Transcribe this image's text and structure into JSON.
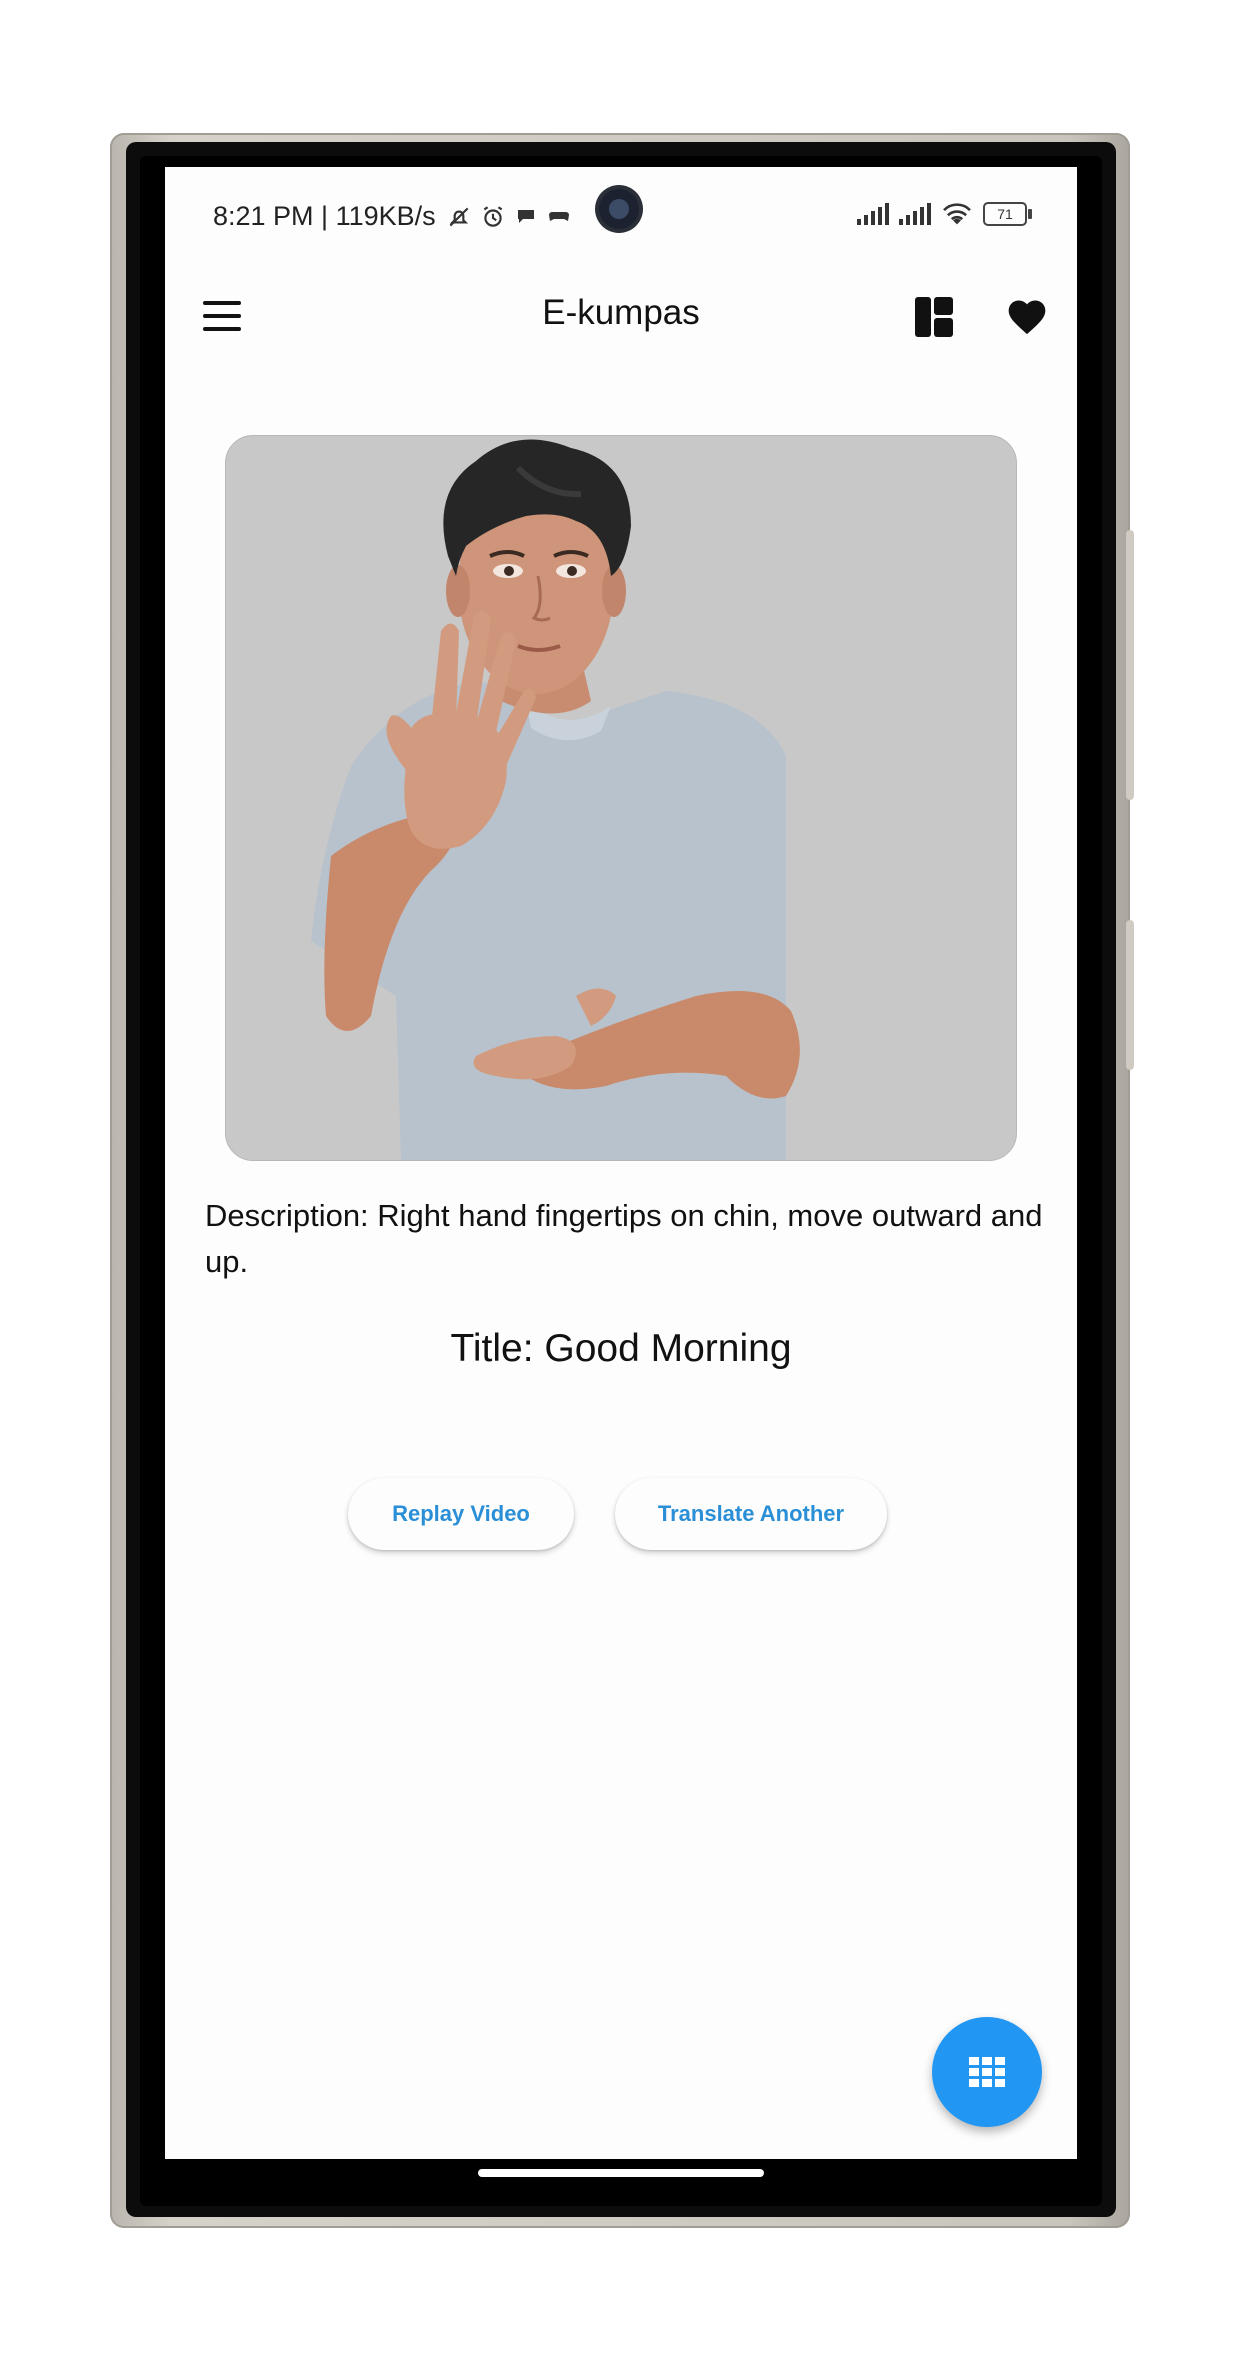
{
  "status_bar": {
    "time_info": "8:21 PM | 119KB/s",
    "battery": "71",
    "icons": [
      "bell-off-icon",
      "alarm-icon",
      "chat-icon",
      "game-controller-icon",
      "signal-icon",
      "signal-icon",
      "wifi-icon",
      "battery-icon"
    ]
  },
  "app_bar": {
    "title": "E-kumpas",
    "icons": [
      "menu-icon",
      "dashboard-icon",
      "heart-icon"
    ]
  },
  "content": {
    "description": "Description: Right hand fingertips on chin, move outward and up.",
    "title": "Title: Good Morning",
    "replay_label": "Replay Video",
    "translate_label": "Translate Another"
  },
  "fab": {
    "icon": "grid-icon"
  },
  "colors": {
    "accent": "#2196f3",
    "button_text": "#2a8fd6",
    "video_background": "#c8c8c8"
  }
}
